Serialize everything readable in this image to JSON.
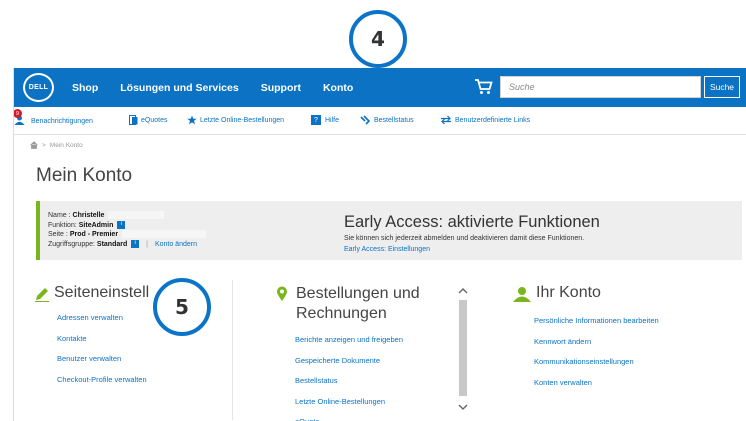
{
  "callouts": {
    "top": "4",
    "side": "5"
  },
  "nav": {
    "logo": "DELL",
    "links": [
      "Shop",
      "Lösungen und Services",
      "Support",
      "Konto"
    ],
    "search_placeholder": "Suche",
    "search_button": "Suche"
  },
  "utility": {
    "notifications": "Benachrichtigungen",
    "notifications_count": "9",
    "equotes": "eQuotes",
    "recent_orders": "Letzte Online-Bestellungen",
    "help": "Hilfe",
    "order_status": "Bestellstatus",
    "custom_links": "Benutzerdefinierte Links"
  },
  "breadcrumb": {
    "current": "Mein Konto"
  },
  "page_title": "Mein Konto",
  "account": {
    "name_label": "Name :",
    "name_value": "Christelle",
    "role_label": "Funktion:",
    "role_value": "SiteAdmin",
    "site_label": "Seite :",
    "site_value": "Prod - Premier",
    "group_label": "Zugriffsgruppe:",
    "group_value": "Standard",
    "info_icon": "i",
    "separator": "|",
    "change_account": "Konto ändern"
  },
  "early_access": {
    "title": "Early Access: aktivierte Funktionen",
    "description": "Sie können sich jederzeit abmelden und deaktivieren damit diese Funktionen.",
    "link": "Early Access: Einstellungen"
  },
  "columns": {
    "site": {
      "heading": "Seiteneinstell",
      "links": [
        "Adressen verwalten",
        "Kontakte",
        "Benutzer verwalten",
        "Checkout-Profile verwalten"
      ]
    },
    "orders": {
      "heading_line1": "Bestellungen und",
      "heading_line2": "Rechnungen",
      "links": [
        "Berichte anzeigen und freigeben",
        "Gespeicherte Dokumente",
        "Bestellstatus",
        "Letzte Online-Bestellungen",
        "eQuote"
      ]
    },
    "account": {
      "heading": "Ihr Konto",
      "links": [
        "Persönliche Informationen bearbeiten",
        "Kennwort ändern",
        "Kommunikationseinstellungen",
        "Konten verwalten"
      ]
    }
  },
  "colors": {
    "dell_blue": "#0b72c4",
    "accent_green": "#7ab51d",
    "badge_red": "#d11a2a",
    "callout_blue": "#0b74c9"
  }
}
